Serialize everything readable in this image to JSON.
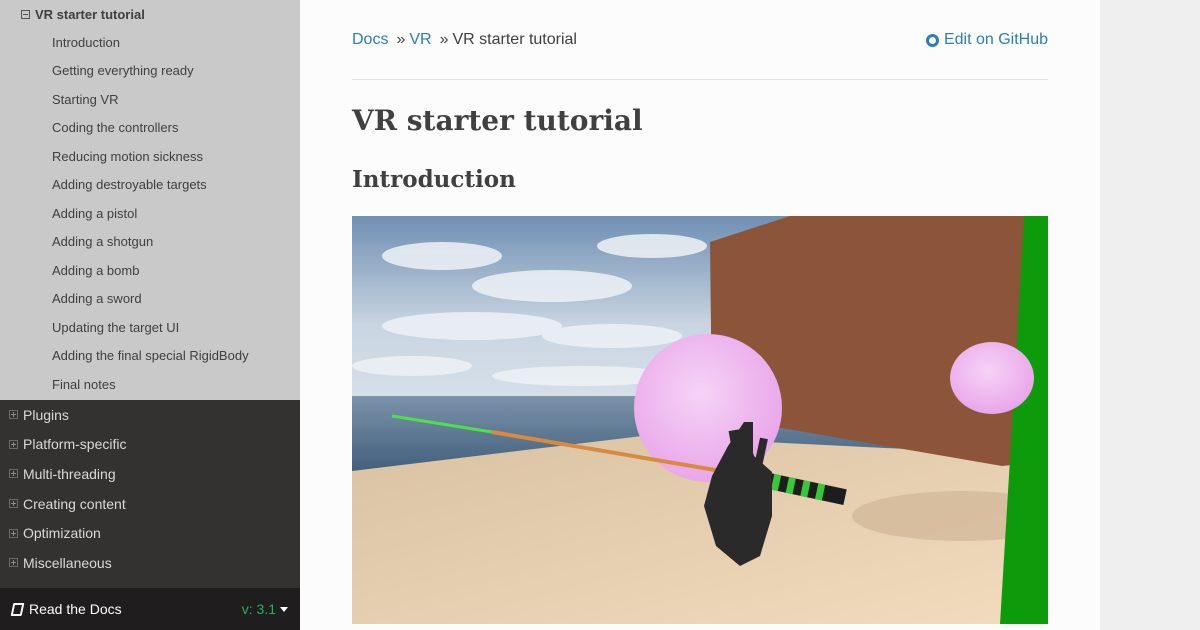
{
  "sidebar": {
    "current_section": "VR starter tutorial",
    "subsections": [
      "Introduction",
      "Getting everything ready",
      "Starting VR",
      "Coding the controllers",
      "Reducing motion sickness",
      "Adding destroyable targets",
      "Adding a pistol",
      "Adding a shotgun",
      "Adding a bomb",
      "Adding a sword",
      "Updating the target UI",
      "Adding the final special RigidBody",
      "Final notes"
    ],
    "top_level": [
      "Plugins",
      "Platform-specific",
      "Multi-threading",
      "Creating content",
      "Optimization",
      "Miscellaneous"
    ],
    "footer": {
      "label": "Read the Docs",
      "version": "v: 3.1"
    }
  },
  "breadcrumbs": {
    "root": "Docs",
    "parent": "VR",
    "current": "VR starter tutorial",
    "separator": "»"
  },
  "edit_link": "Edit on GitHub",
  "page_title": "VR starter tutorial",
  "section_title": "Introduction",
  "colors": {
    "link": "#2980b9",
    "text": "#404040",
    "sidebar_dark": "#343131",
    "sidebar_current": "#c9c9c9",
    "version_green": "#27ae60"
  },
  "icons": {
    "collapse": "minus-square-icon",
    "expand": "plus-square-icon",
    "github": "github-icon",
    "book": "book-icon",
    "caret": "caret-down-icon"
  }
}
